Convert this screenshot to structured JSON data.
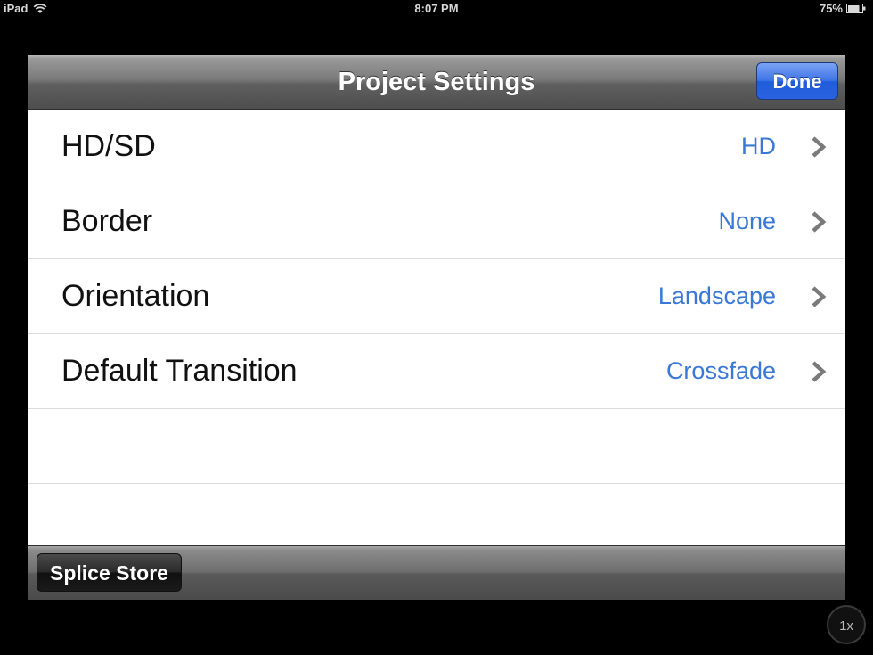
{
  "status_bar": {
    "device": "iPad",
    "time": "8:07 PM",
    "battery": "75%"
  },
  "navbar": {
    "title": "Project Settings",
    "done_label": "Done"
  },
  "settings": [
    {
      "label": "HD/SD",
      "value": "HD"
    },
    {
      "label": "Border",
      "value": "None"
    },
    {
      "label": "Orientation",
      "value": "Landscape"
    },
    {
      "label": "Default Transition",
      "value": "Crossfade"
    }
  ],
  "toolbar": {
    "store_label": "Splice Store"
  },
  "zoom_badge": "1x",
  "colors": {
    "value_text": "#3a78d6",
    "done_button": "#2a63e0"
  },
  "icons": [
    "wifi-icon",
    "battery-icon",
    "chevron-right-icon"
  ]
}
